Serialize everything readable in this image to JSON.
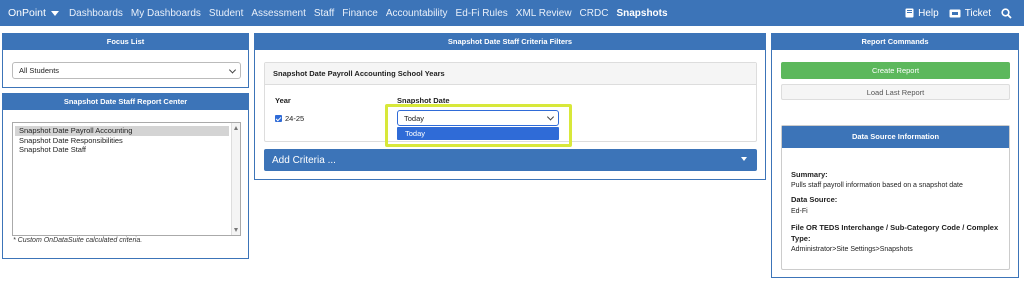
{
  "nav": {
    "brand": "OnPoint",
    "items": [
      "Dashboards",
      "My Dashboards",
      "Student",
      "Assessment",
      "Staff",
      "Finance",
      "Accountability",
      "Ed-Fi Rules",
      "XML Review",
      "CRDC",
      "Snapshots"
    ],
    "active": "Snapshots",
    "help": "Help",
    "ticket": "Ticket"
  },
  "focus_list": {
    "title": "Focus List",
    "selected": "All Students"
  },
  "report_center": {
    "title": "Snapshot Date Staff Report Center",
    "items": [
      "Snapshot Date Payroll Accounting",
      "Snapshot Date Responsibilities",
      "Snapshot Date Staff"
    ],
    "selected_index": 0,
    "note": "* Custom OnDataSuite calculated criteria."
  },
  "criteria": {
    "title": "Snapshot Date Staff Criteria Filters",
    "subpanel_title": "Snapshot Date Payroll Accounting School Years",
    "year_label": "Year",
    "snapshot_label": "Snapshot Date",
    "year_value": "24-25",
    "snapshot_value": "Today",
    "dropdown_option": "Today",
    "add_criteria": "Add Criteria ..."
  },
  "commands": {
    "title": "Report Commands",
    "create": "Create Report",
    "load_last": "Load Last Report"
  },
  "data_source": {
    "title": "Data Source Information",
    "summary_label": "Summary:",
    "summary_text": "Pulls staff payroll information based on a snapshot date",
    "source_label": "Data Source:",
    "source_text": "Ed-Fi",
    "file_label": "File OR TEDS Interchange / Sub-Category Code / Complex Type:",
    "file_text": "Administrator>Site Settings>Snapshots"
  },
  "colors": {
    "nav": "#3c74b8",
    "accent": "#2f6bd7",
    "highlight": "#d8e83a",
    "create": "#5cb85c"
  }
}
